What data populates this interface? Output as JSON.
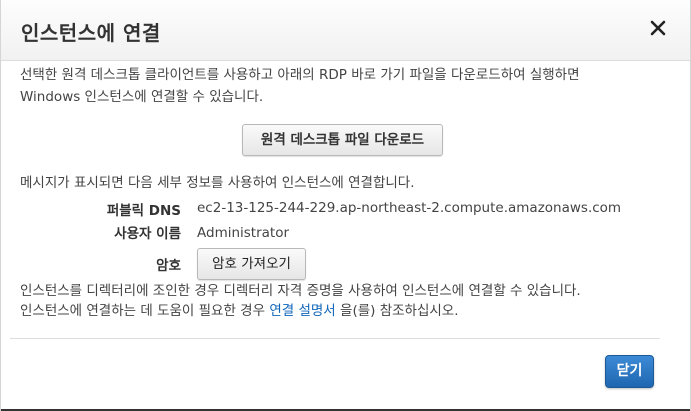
{
  "dialog": {
    "title": "인스턴스에 연결",
    "close_icon": "close-icon"
  },
  "intro": {
    "line1": "선택한 원격 데스크톱 클라이언트를 사용하고 아래의 RDP 바로 가기 파일을 다운로드하여 실행하면",
    "line2": "Windows 인스턴스에 연결할 수 있습니다."
  },
  "download_button": "원격 데스크톱 파일 다운로드",
  "prompt_text": "메시지가 표시되면 다음 세부 정보를 사용하여 인스턴스에 연결합니다.",
  "details": {
    "dns_label": "퍼블릭 DNS",
    "dns_value": "ec2-13-125-244-229.ap-northeast-2.compute.amazonaws.com",
    "user_label": "사용자 이름",
    "user_value": "Administrator",
    "password_label": "암호",
    "password_button": "암호 가져오기"
  },
  "footer_text": {
    "line1": "인스턴스를 디렉터리에 조인한 경우 디렉터리 자격 증명을 사용하여 인스턴스에 연결할 수 있습니다.",
    "line2_prefix": "인스턴스에 연결하는 데 도움이 필요한 경우",
    "line2_link": "연결 설명서",
    "line2_suffix": "을(를) 참조하십시오."
  },
  "close_button": "닫기",
  "colors": {
    "primary_button": "#2a74c2",
    "link": "#1166bb"
  }
}
